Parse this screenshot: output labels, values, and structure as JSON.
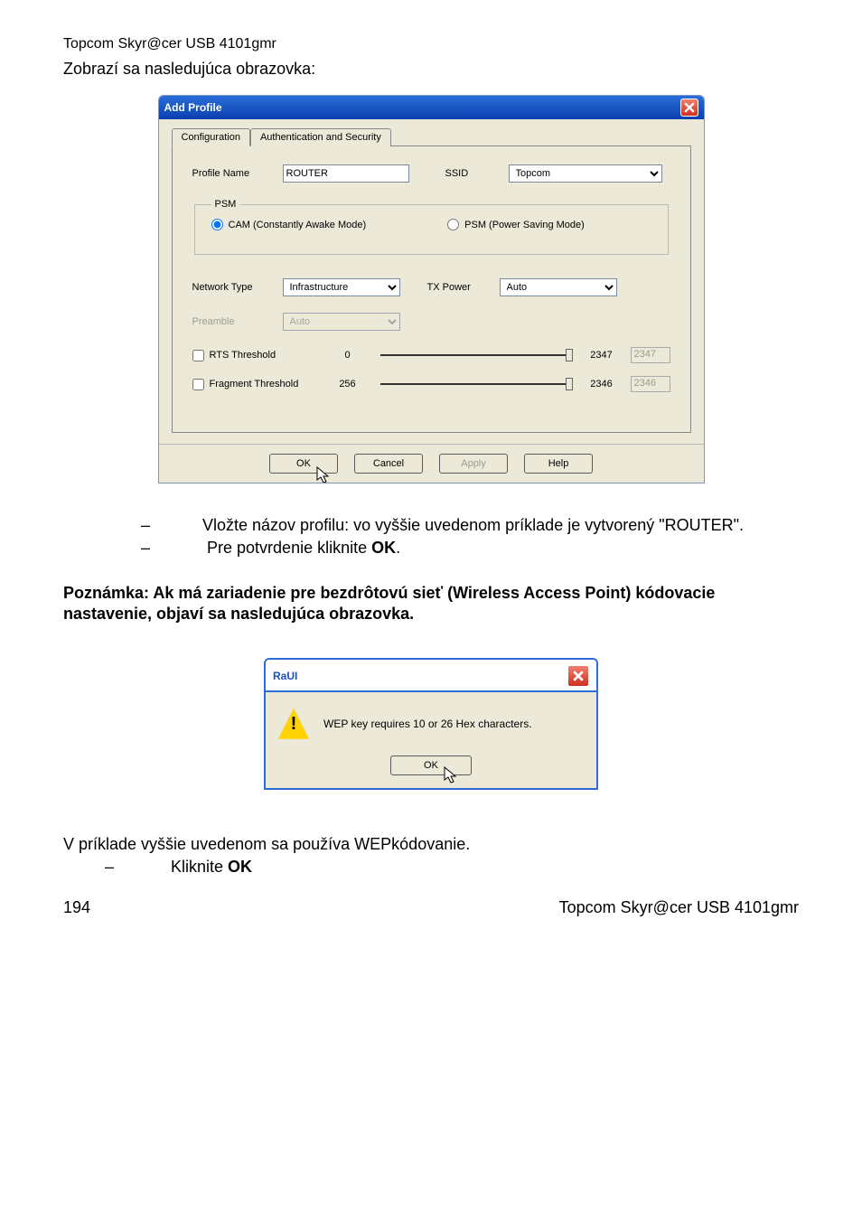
{
  "doc": {
    "header": "Topcom Skyr@cer USB 4101gmr",
    "subheader": "Zobrazí sa nasledujúca obrazovka:",
    "bullet1_pre": "Vložte názov profilu: vo vyššie uvedenom príklade je vytvorený \"ROUTER\".",
    "bullet2_pre": "Pre potvrdenie kliknite ",
    "bullet2_bold": "OK",
    "bullet2_post": ".",
    "note": "Poznámka: Ak má zariadenie pre bezdrôtovú sieť (Wireless Access Point) kódovacie nastavenie, objaví sa nasledujúca obrazovka.",
    "tail1": "V príklade vyššie uvedenom sa používa WEPkódovanie.",
    "tail2_pre": "Kliknite ",
    "tail2_bold": "OK",
    "page_num": "194",
    "footer_right": "Topcom Skyr@cer USB 4101gmr"
  },
  "dialog1": {
    "title": "Add Profile",
    "tabs": {
      "config": "Configuration",
      "auth": "Authentication and Security"
    },
    "labels": {
      "profile_name": "Profile Name",
      "ssid": "SSID",
      "psm_legend": "PSM",
      "cam": "CAM (Constantly Awake Mode)",
      "psm": "PSM (Power Saving Mode)",
      "network_type": "Network Type",
      "tx_power": "TX Power",
      "preamble": "Preamble",
      "rts": "RTS Threshold",
      "frag": "Fragment Threshold"
    },
    "values": {
      "profile_name": "ROUTER",
      "ssid": "Topcom",
      "network_type": "Infrastructure",
      "tx_power": "Auto",
      "preamble": "Auto",
      "rts_min": "0",
      "rts_max": "2347",
      "rts_val": "2347",
      "frag_min": "256",
      "frag_max": "2346",
      "frag_val": "2346"
    },
    "buttons": {
      "ok": "OK",
      "cancel": "Cancel",
      "apply": "Apply",
      "help": "Help"
    }
  },
  "dialog2": {
    "title": "RaUI",
    "msg": "WEP key requires 10 or 26 Hex characters.",
    "ok": "OK"
  }
}
